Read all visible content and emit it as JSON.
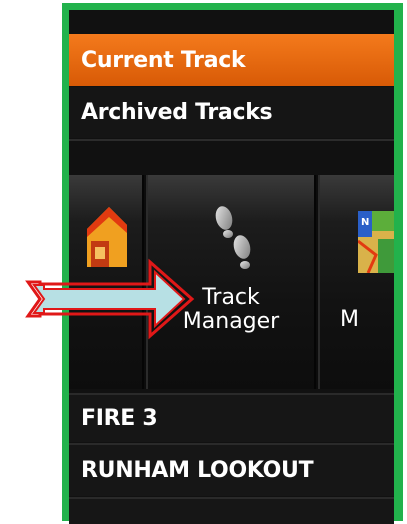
{
  "menu": {
    "current_track": "Current Track",
    "archived_tracks": "Archived Tracks"
  },
  "carousel": {
    "items": [
      {
        "label": "",
        "icon": "home-icon"
      },
      {
        "label_line1": "Track",
        "label_line2": "Manager",
        "icon": "footprints-icon"
      },
      {
        "label": "M",
        "icon": "map-icon"
      }
    ]
  },
  "tracks": {
    "items": [
      {
        "label": "FIRE 3"
      },
      {
        "label": "RUNHAM LOOKOUT"
      }
    ]
  },
  "colors": {
    "frame": "#22b24c",
    "highlight": "#e8680f",
    "arrow_fill": "#b7e0e4",
    "arrow_stroke": "#e01818"
  }
}
